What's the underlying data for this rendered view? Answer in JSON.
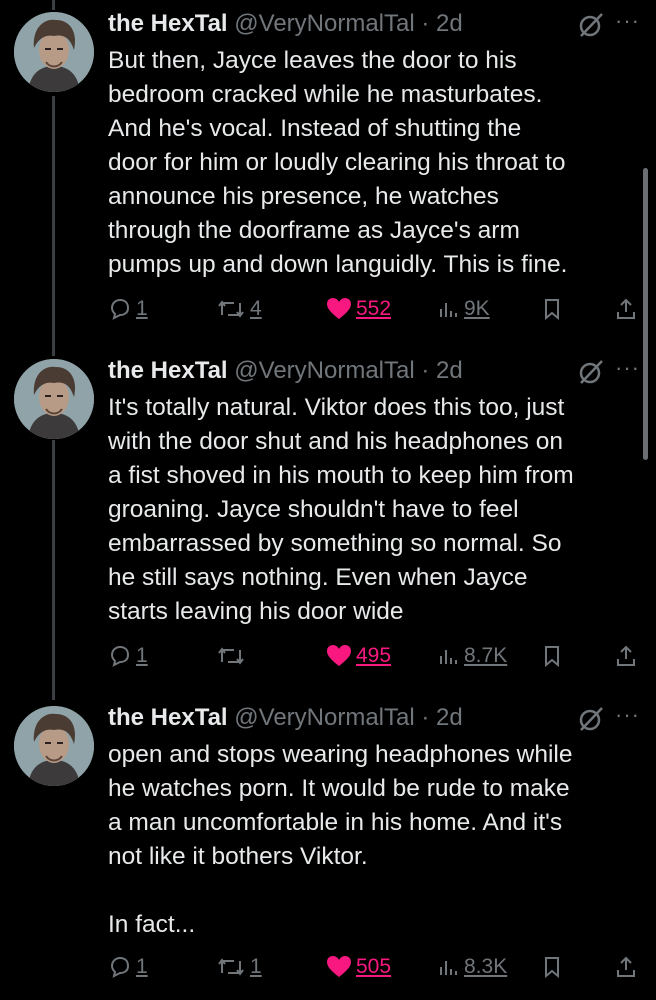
{
  "tweets": [
    {
      "name": "the HexTal",
      "handle": "@VeryNormalTal",
      "separator": "·",
      "time": "2d",
      "text": "But then, Jayce leaves the door to his\nbedroom cracked while he masturbates.\nAnd he's vocal. Instead of shutting the\ndoor for him or loudly clearing his throat to\nannounce his presence, he watches\nthrough the doorframe as Jayce's arm\npumps up and down languidly. This is fine.",
      "replies": "1",
      "retweets": "4",
      "likes": "552",
      "views": "9K"
    },
    {
      "name": "the HexTal",
      "handle": "@VeryNormalTal",
      "separator": "·",
      "time": "2d",
      "text": "It's totally natural. Viktor does this too, just\nwith the door shut and his headphones on\na fist shoved in his mouth to keep him from\ngroaning. Jayce shouldn't have to feel\nembarrassed by something so normal. So\nhe still says nothing. Even when Jayce\nstarts leaving his door wide",
      "replies": "1",
      "retweets": "",
      "likes": "495",
      "views": "8.7K"
    },
    {
      "name": "the HexTal",
      "handle": "@VeryNormalTal",
      "separator": "·",
      "time": "2d",
      "text": "open and stops wearing headphones while\nhe watches porn. It would be rude to make\na man uncomfortable in his home. And it's\nnot like it bothers Viktor.\n\nIn fact...",
      "replies": "1",
      "retweets": "1",
      "likes": "505",
      "views": "8.3K"
    }
  ],
  "more_glyph": "···",
  "icons": {
    "reply": "reply-icon",
    "retweet": "retweet-icon",
    "like": "heart-icon",
    "views": "views-icon",
    "bookmark": "bookmark-icon",
    "share": "share-icon",
    "grok": "grok-icon",
    "more": "more-icon"
  },
  "colors": {
    "background": "#000000",
    "text": "#e7e9ea",
    "muted": "#71767b",
    "like": "#f91880",
    "thread_line": "#3b3e42"
  }
}
